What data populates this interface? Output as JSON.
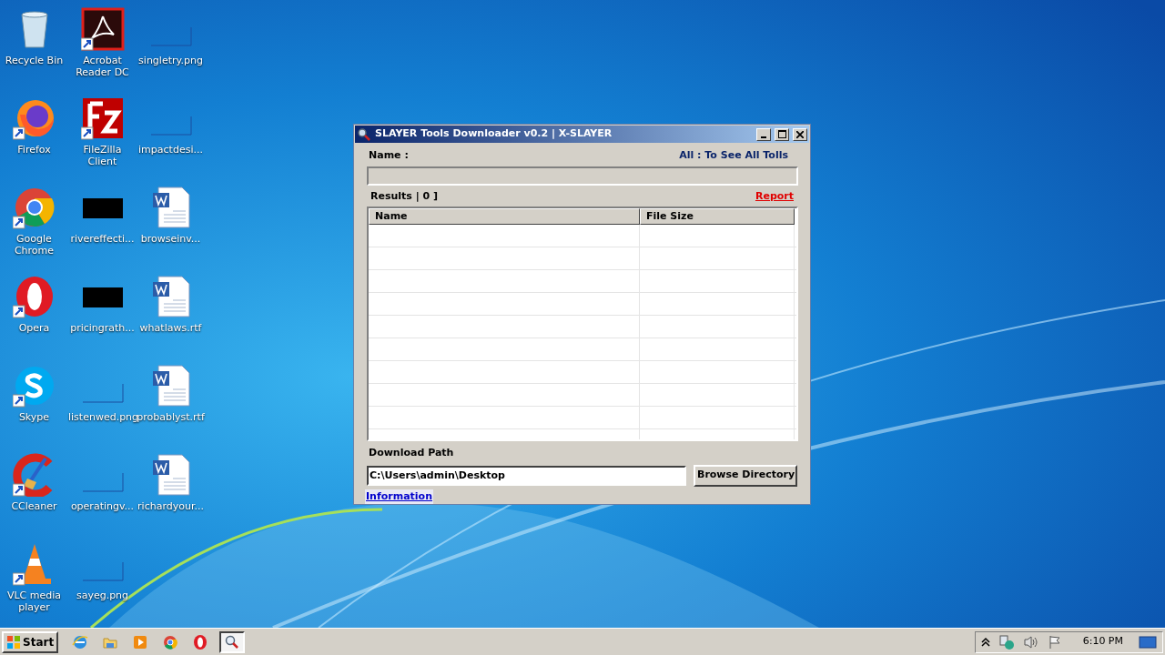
{
  "desktop_icons": [
    {
      "label": "Recycle Bin",
      "kind": "recycle",
      "shortcut": false
    },
    {
      "label": "Firefox",
      "kind": "firefox",
      "shortcut": true
    },
    {
      "label": "Google Chrome",
      "kind": "chrome",
      "shortcut": true
    },
    {
      "label": "Opera",
      "kind": "opera",
      "shortcut": true
    },
    {
      "label": "Skype",
      "kind": "skype",
      "shortcut": true
    },
    {
      "label": "CCleaner",
      "kind": "ccleaner",
      "shortcut": true
    },
    {
      "label": "VLC media player",
      "kind": "vlc",
      "shortcut": true
    },
    {
      "label": "Acrobat Reader DC",
      "kind": "acrobat",
      "shortcut": true
    },
    {
      "label": "FileZilla Client",
      "kind": "filezilla",
      "shortcut": true
    },
    {
      "label": "rivereffecti...",
      "kind": "black",
      "shortcut": false
    },
    {
      "label": "pricingrath...",
      "kind": "black",
      "shortcut": false
    },
    {
      "label": "listenwed.png",
      "kind": "image",
      "shortcut": false
    },
    {
      "label": "operatingv...",
      "kind": "image",
      "shortcut": false
    },
    {
      "label": "sayeg.png",
      "kind": "image",
      "shortcut": false
    },
    {
      "label": "singletry.png",
      "kind": "image",
      "shortcut": false
    },
    {
      "label": "impactdesi...",
      "kind": "image",
      "shortcut": false
    },
    {
      "label": "browseinv...",
      "kind": "word",
      "shortcut": false
    },
    {
      "label": "whatlaws.rtf",
      "kind": "word",
      "shortcut": false
    },
    {
      "label": "probablyst.rtf",
      "kind": "word",
      "shortcut": false
    },
    {
      "label": "richardyour...",
      "kind": "word",
      "shortcut": false
    }
  ],
  "window": {
    "title": "SLAYER Tools Downloader v0.2 | X-SLAYER",
    "name_label": "Name :",
    "hint": "All : To See All Tolls",
    "results_label": "Results | 0 ]",
    "report_link": "Report",
    "table": {
      "columns": [
        "Name",
        "File Size"
      ]
    },
    "download_path_label": "Download Path",
    "download_path": "C:\\Users\\admin\\Desktop",
    "browse_button": "Browse Directory",
    "info_link": "Information"
  },
  "taskbar": {
    "start": "Start",
    "items": [
      {
        "kind": "ie",
        "selected": false
      },
      {
        "kind": "folder",
        "selected": false
      },
      {
        "kind": "media",
        "selected": false
      },
      {
        "kind": "chrome",
        "selected": false
      },
      {
        "kind": "opera",
        "selected": false
      },
      {
        "kind": "search",
        "selected": true
      }
    ],
    "clock": "6:10 PM"
  }
}
